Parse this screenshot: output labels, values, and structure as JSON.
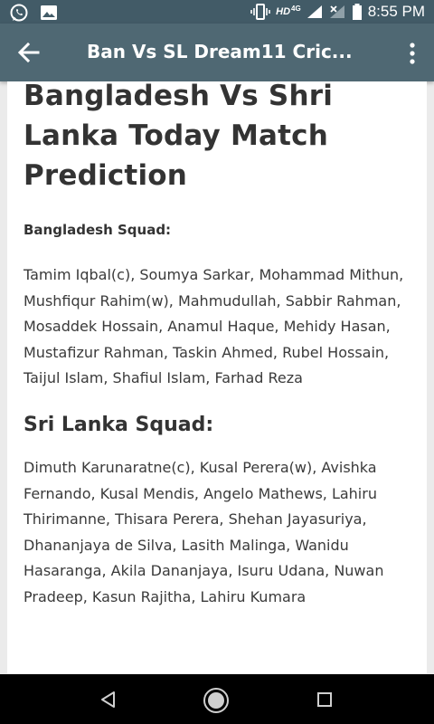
{
  "status_bar": {
    "time": "8:55 PM",
    "network_label": "HD",
    "network_type": "4G",
    "icons": [
      "whatsapp-icon",
      "gallery-icon",
      "vibrate-icon",
      "signal-icon",
      "no-signal-icon",
      "battery-icon"
    ]
  },
  "app_bar": {
    "title": "Ban Vs SL Dream11 Cric...",
    "back_icon": "arrow-left-icon",
    "menu_icon": "more-vertical-icon"
  },
  "article": {
    "heading": "Bangladesh Vs Shri Lanka Today Match Prediction",
    "bangladesh_squad_label": "Bangladesh Squad:",
    "bangladesh_players": "Tamim Iqbal(c), Soumya Sarkar, Mohammad Mithun, Mushfiqur Rahim(w), Mahmudullah, Sabbir Rahman, Mosaddek Hossain, Anamul Haque, Mehidy Hasan, Mustafizur Rahman, Taskin Ahmed, Rubel Hossain, Taijul Islam, Shafiul Islam, Farhad Reza",
    "srilanka_squad_label": "Sri Lanka Squad:",
    "srilanka_players": "Dimuth Karunaratne(c), Kusal Perera(w), Avishka Fernando, Kusal Mendis, Angelo Mathews, Lahiru Thirimanne, Thisara Perera, Shehan Jayasuriya, Dhananjaya de Silva, Lasith Malinga, Wanidu Hasaranga, Akila Dananjaya, Isuru Udana, Nuwan Pradeep, Kasun Rajitha, Lahiru Kumara"
  },
  "nav_bar": {
    "icons": [
      "nav-back-icon",
      "nav-home-icon",
      "nav-recent-icon"
    ]
  },
  "colors": {
    "status_bar": "#425b67",
    "app_bar": "#4f6873",
    "page_background": "#ebebeb",
    "card": "#ffffff",
    "text": "#333333",
    "nav_bar": "#000000"
  }
}
